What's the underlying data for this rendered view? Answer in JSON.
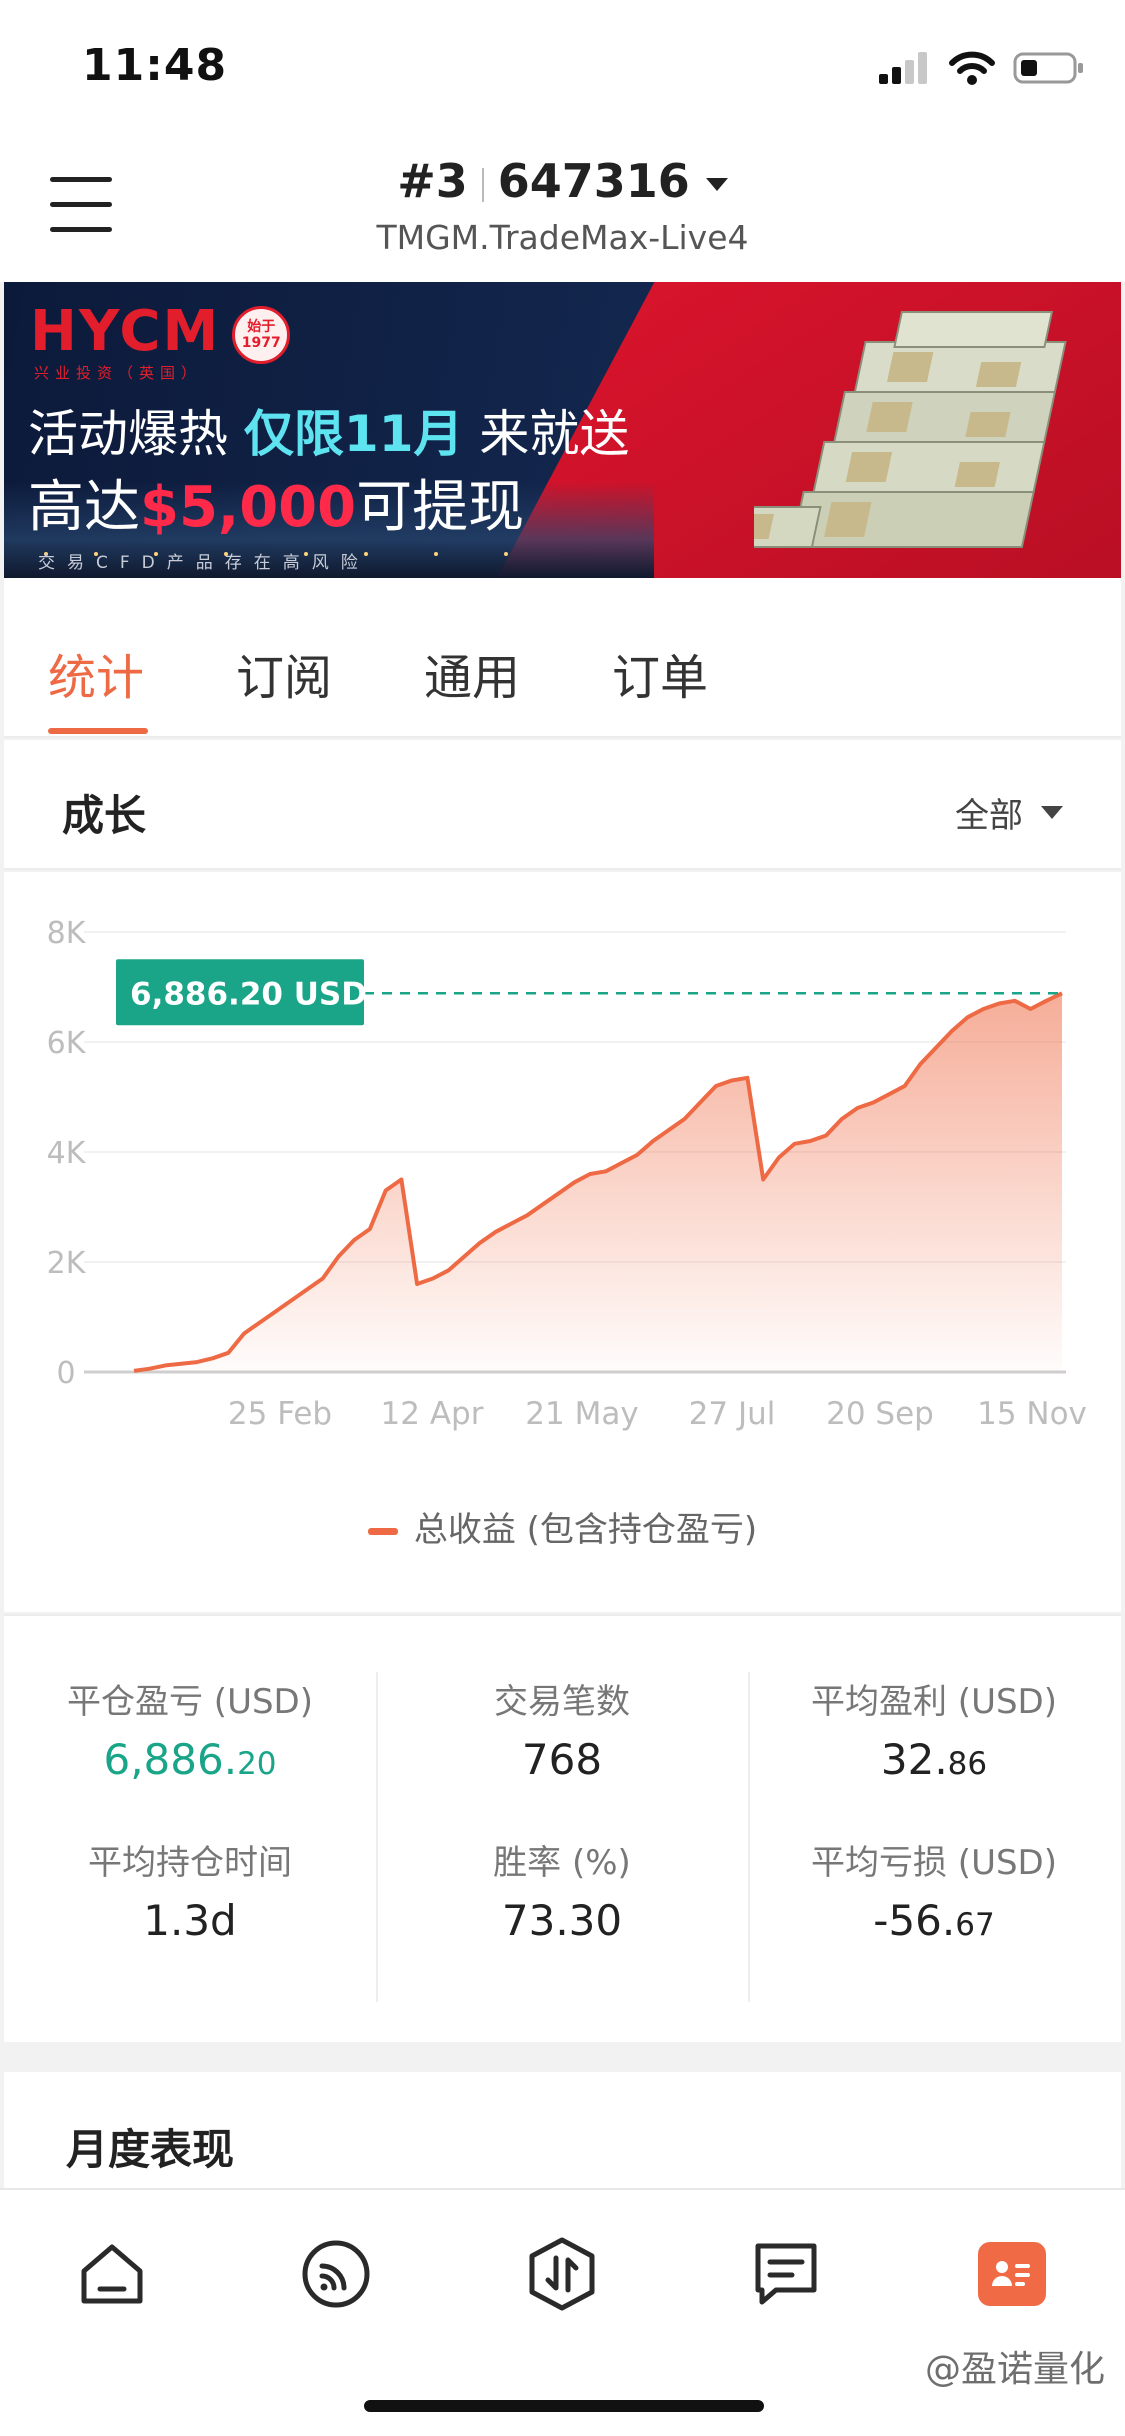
{
  "status_bar": {
    "time": "11:48"
  },
  "header": {
    "account_index": "#3",
    "account_number": "647316",
    "server": "TMGM.TradeMax-Live4",
    "menu_icon": "hamburger-menu-icon"
  },
  "banner": {
    "logo": "HYCM",
    "logo_sub": "兴业投资（英国）",
    "badge_top": "始于",
    "badge_year": "1977",
    "line1_prefix": "活动爆热 ",
    "line1_highlight": "仅限11月",
    "line1_suffix": " 来就送",
    "line2_prefix": "高达",
    "line2_amount": "$5,000",
    "line2_suffix": "可提现",
    "disclaimer": "交易CFD产品存在高风险",
    "colors": {
      "red": "#e31e2c",
      "cyan": "#5ee3f0",
      "navy": "#13264d"
    }
  },
  "tabs": [
    {
      "label": "统计",
      "active": true
    },
    {
      "label": "订阅",
      "active": false
    },
    {
      "label": "通用",
      "active": false
    },
    {
      "label": "订单",
      "active": false
    }
  ],
  "growth": {
    "title": "成长",
    "filter": "全部",
    "legend": "总收益 (包含持仓盈亏)"
  },
  "chart_data": {
    "type": "area",
    "title": "",
    "xlabel": "",
    "ylabel": "",
    "ylim": [
      0,
      8000
    ],
    "y_ticks": [
      "0",
      "2K",
      "4K",
      "6K",
      "8K"
    ],
    "x_ticks": [
      "25 Feb",
      "12 Apr",
      "21 May",
      "27 Jul",
      "20 Sep",
      "15 Nov"
    ],
    "current_value_label": "6,886.20 USD",
    "current_value": 6886.2,
    "grid": true,
    "series": [
      {
        "name": "总收益 (包含持仓盈亏)",
        "color": "#ee6a44",
        "points": [
          [
            0,
            20
          ],
          [
            1,
            60
          ],
          [
            2,
            120
          ],
          [
            3,
            150
          ],
          [
            4,
            180
          ],
          [
            5,
            250
          ],
          [
            6,
            350
          ],
          [
            7,
            700
          ],
          [
            8,
            900
          ],
          [
            9,
            1100
          ],
          [
            10,
            1300
          ],
          [
            11,
            1500
          ],
          [
            12,
            1700
          ],
          [
            13,
            2100
          ],
          [
            14,
            2400
          ],
          [
            15,
            2600
          ],
          [
            16,
            3300
          ],
          [
            17,
            3500
          ],
          [
            18,
            1600
          ],
          [
            19,
            1700
          ],
          [
            20,
            1850
          ],
          [
            21,
            2100
          ],
          [
            22,
            2350
          ],
          [
            23,
            2550
          ],
          [
            24,
            2700
          ],
          [
            25,
            2850
          ],
          [
            26,
            3050
          ],
          [
            27,
            3250
          ],
          [
            28,
            3450
          ],
          [
            29,
            3600
          ],
          [
            30,
            3650
          ],
          [
            31,
            3800
          ],
          [
            32,
            3950
          ],
          [
            33,
            4200
          ],
          [
            34,
            4400
          ],
          [
            35,
            4600
          ],
          [
            36,
            4900
          ],
          [
            37,
            5200
          ],
          [
            38,
            5300
          ],
          [
            39,
            5350
          ],
          [
            40,
            3500
          ],
          [
            41,
            3900
          ],
          [
            42,
            4150
          ],
          [
            43,
            4200
          ],
          [
            44,
            4300
          ],
          [
            45,
            4600
          ],
          [
            46,
            4800
          ],
          [
            47,
            4900
          ],
          [
            48,
            5050
          ],
          [
            49,
            5200
          ],
          [
            50,
            5600
          ],
          [
            51,
            5900
          ],
          [
            52,
            6200
          ],
          [
            53,
            6450
          ],
          [
            54,
            6600
          ],
          [
            55,
            6700
          ],
          [
            56,
            6750
          ],
          [
            57,
            6600
          ],
          [
            58,
            6750
          ],
          [
            59,
            6886.2
          ]
        ]
      }
    ]
  },
  "stats": {
    "closed_pnl": {
      "label": "平仓盈亏 (USD)",
      "int": "6,886.",
      "dec": "20"
    },
    "trades": {
      "label": "交易笔数",
      "value": "768"
    },
    "avg_profit": {
      "label": "平均盈利 (USD)",
      "int": "32.",
      "dec": "86"
    },
    "avg_hold": {
      "label": "平均持仓时间",
      "value": "1.3d"
    },
    "win_rate": {
      "label": "胜率 (%)",
      "value": "73.30"
    },
    "avg_loss": {
      "label": "平均亏损 (USD)",
      "int": "-56.",
      "dec": "67"
    },
    "colors": {
      "positive": "#1aa589"
    }
  },
  "monthly": {
    "title": "月度表现"
  },
  "bottom_nav": [
    {
      "icon": "home-icon",
      "active": false
    },
    {
      "icon": "feed-icon",
      "active": false
    },
    {
      "icon": "trade-icon",
      "active": false
    },
    {
      "icon": "message-icon",
      "active": false
    },
    {
      "icon": "profile-card-icon",
      "active": true
    }
  ],
  "watermark": "@盈诺量化"
}
